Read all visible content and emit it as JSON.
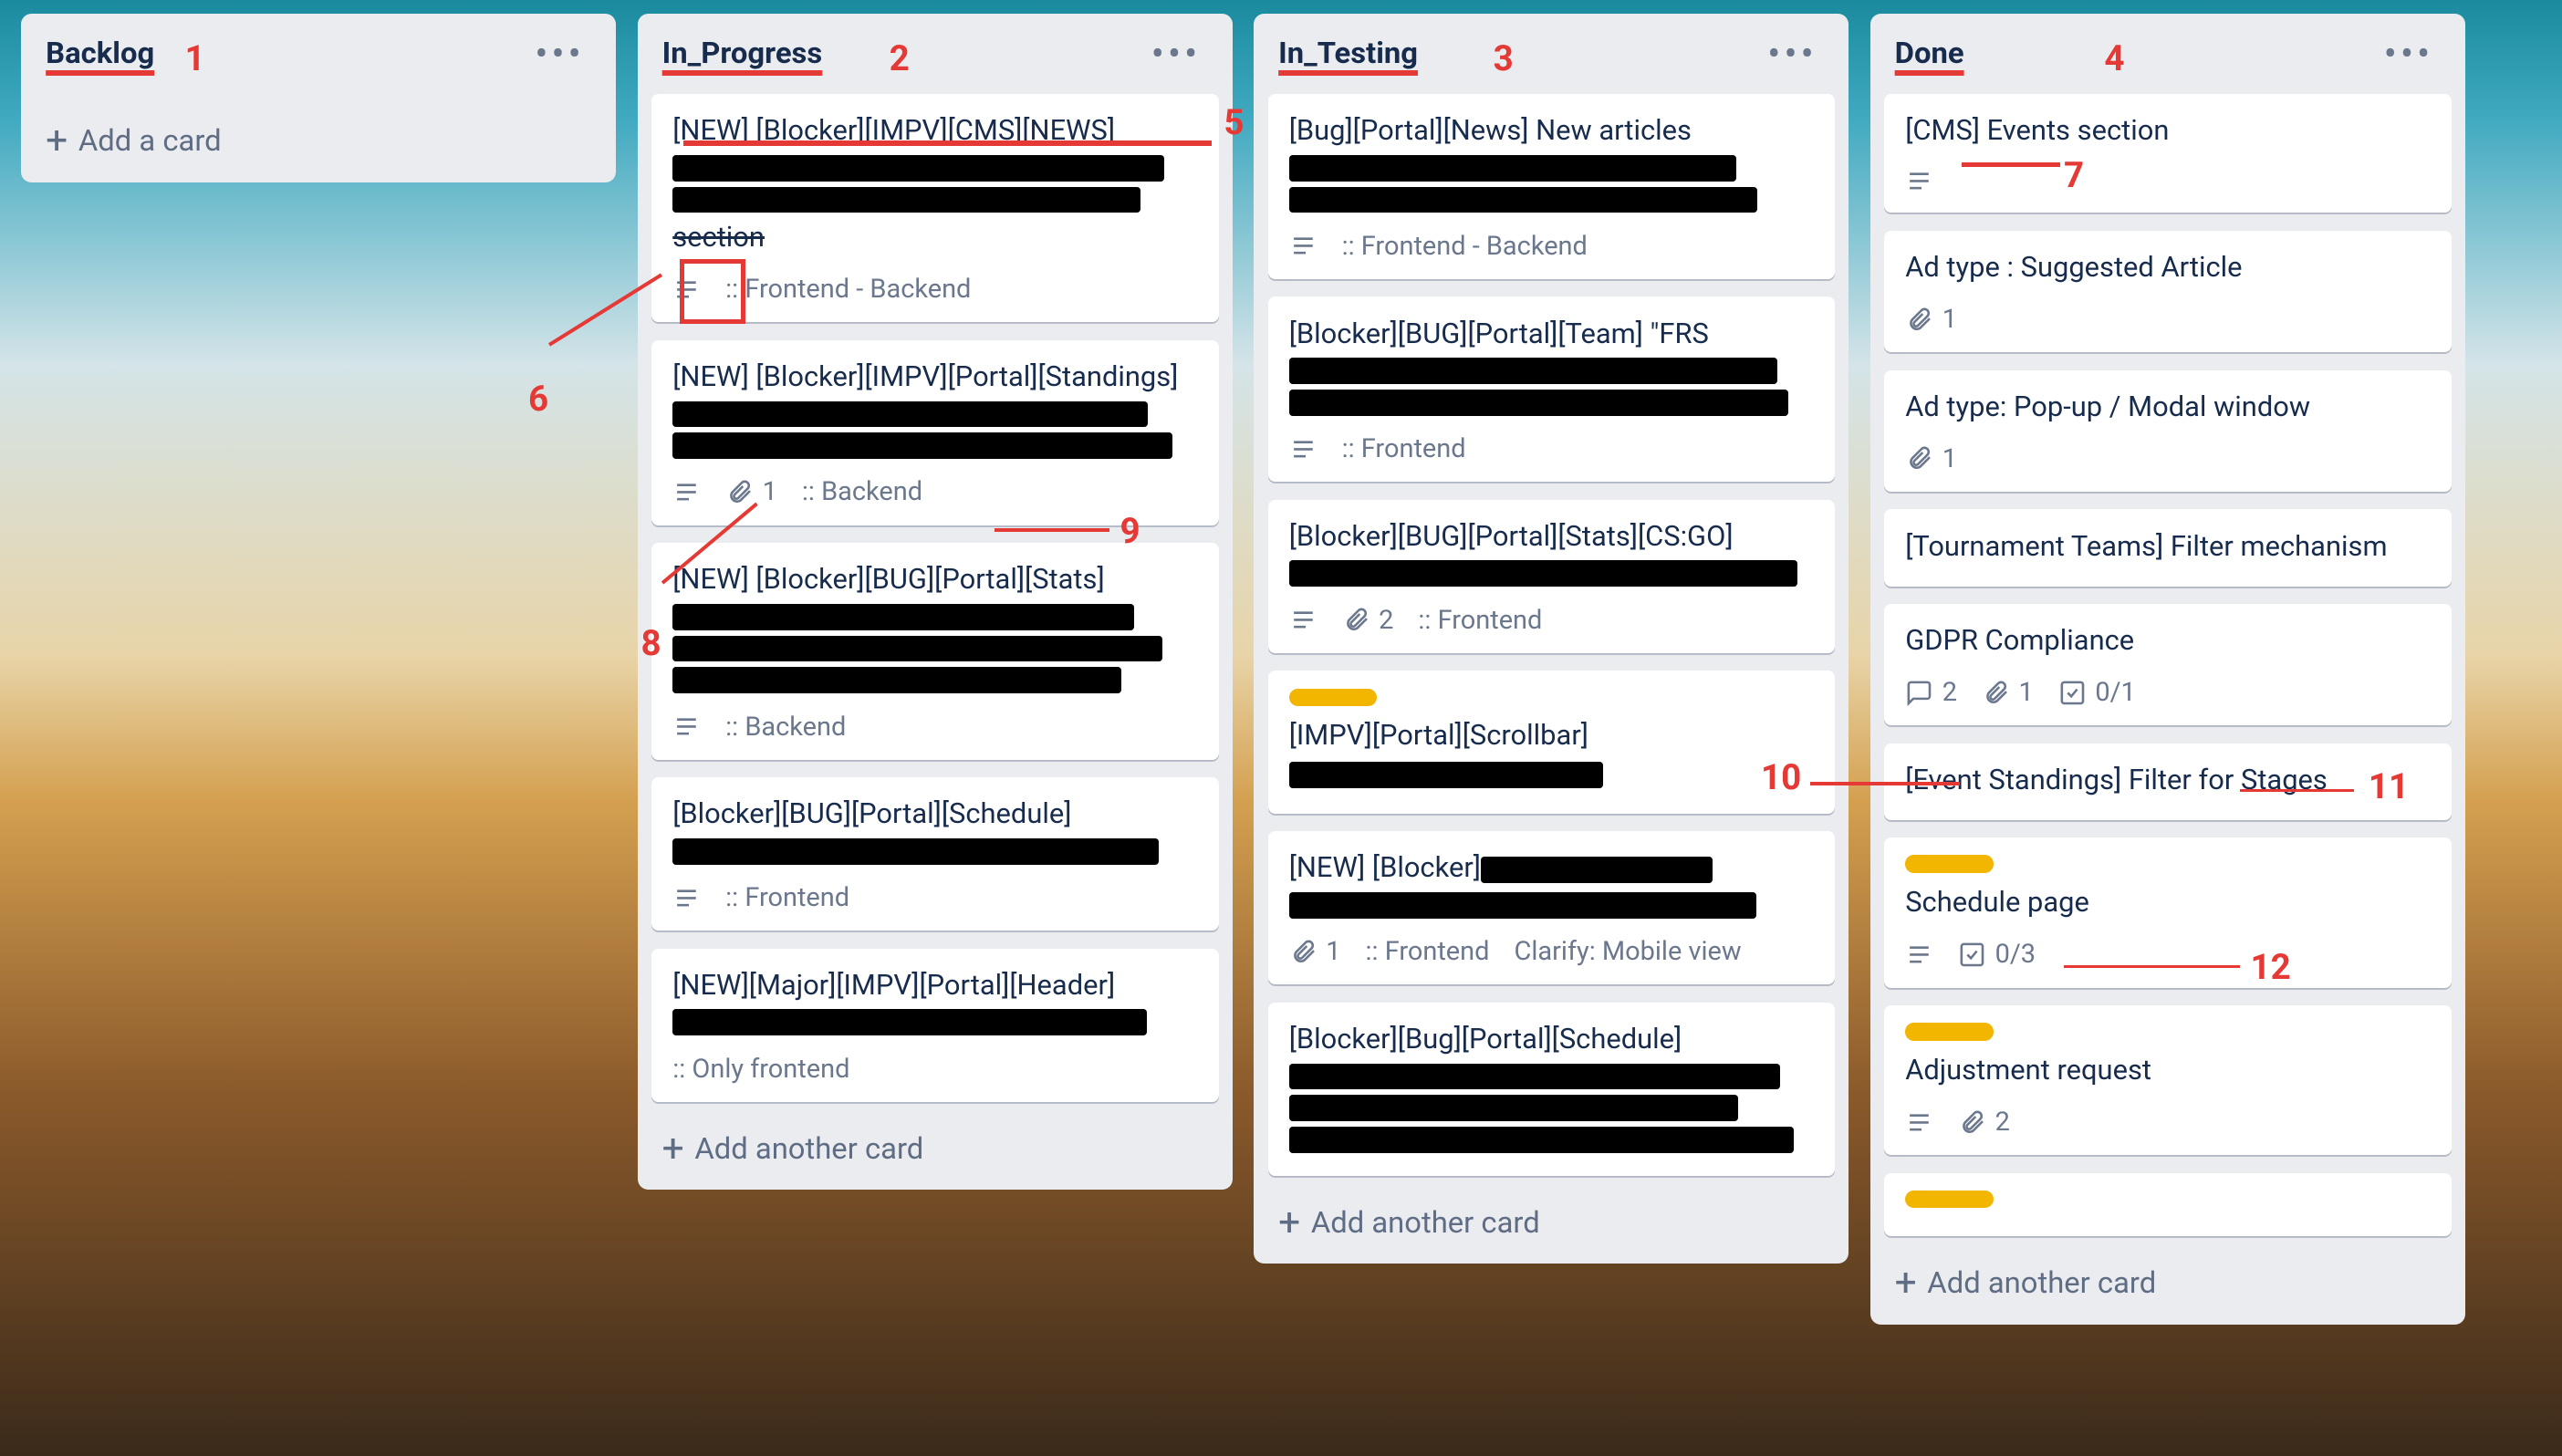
{
  "lists": [
    {
      "id": "backlog",
      "title": "Backlog",
      "annotation": "1",
      "cards": [],
      "add_label": "Add a card"
    },
    {
      "id": "in_progress",
      "title": "In_Progress",
      "annotation": "2",
      "cards": [
        {
          "title_parts": [
            "[NEW] [Blocker][IMPV][CMS][NEWS] ",
            {
              "redacted_lines": 2
            },
            "section"
          ],
          "last_strike": true,
          "badges": [
            {
              "type": "description"
            },
            {
              "type": "text",
              "value": ":: Frontend - Backend"
            }
          ],
          "anno_title": "5"
        },
        {
          "title_parts": [
            "[NEW] [Blocker][IMPV][Portal][Standings] ",
            {
              "redacted_lines": 2
            }
          ],
          "badges": [
            {
              "type": "description"
            },
            {
              "type": "attachment",
              "value": "1"
            },
            {
              "type": "text",
              "value": ":: Backend"
            }
          ],
          "anno_attach": "8",
          "anno_backend": "9"
        },
        {
          "title_parts": [
            "[NEW] [Blocker][BUG][Portal][Stats] ",
            {
              "redacted_lines": 3
            }
          ],
          "badges": [
            {
              "type": "description"
            },
            {
              "type": "text",
              "value": ":: Backend"
            }
          ]
        },
        {
          "title_parts": [
            "[Blocker][BUG][Portal][Schedule] ",
            {
              "redacted_lines": 1
            }
          ],
          "badges": [
            {
              "type": "description"
            },
            {
              "type": "text",
              "value": ":: Frontend"
            }
          ]
        },
        {
          "title_parts": [
            "[NEW][Major][IMPV][Portal][Header] ",
            {
              "redacted_lines": 1
            }
          ],
          "badges": [
            {
              "type": "text",
              "value": ":: Only frontend"
            }
          ]
        }
      ],
      "add_label": "Add another card"
    },
    {
      "id": "in_testing",
      "title": "In_Testing",
      "annotation": "3",
      "cards": [
        {
          "title_parts": [
            "[Bug][Portal][News] New articles ",
            {
              "redacted_lines": 2
            }
          ],
          "badges": [
            {
              "type": "description"
            },
            {
              "type": "text",
              "value": ":: Frontend - Backend"
            }
          ]
        },
        {
          "title_parts": [
            "[Blocker][BUG][Portal][Team] \"FRS ",
            {
              "redacted_lines": 2
            }
          ],
          "badges": [
            {
              "type": "description"
            },
            {
              "type": "text",
              "value": ":: Frontend"
            }
          ]
        },
        {
          "title_parts": [
            "[Blocker][BUG][Portal][Stats][CS:GO] ",
            {
              "redacted_lines": 1
            }
          ],
          "badges": [
            {
              "type": "description"
            },
            {
              "type": "attachment",
              "value": "2"
            },
            {
              "type": "text",
              "value": ":: Frontend"
            }
          ]
        },
        {
          "labels": [
            "yellow"
          ],
          "title_parts": [
            "[IMPV][Portal][Scrollbar]",
            {
              "redacted_lines": 1,
              "inline": true
            }
          ]
        },
        {
          "title_parts": [
            "[NEW] [Blocker]",
            {
              "redacted_lines": 2,
              "inline": true
            }
          ],
          "badges": [
            {
              "type": "attachment",
              "value": "1"
            },
            {
              "type": "text",
              "value": ":: Frontend"
            },
            {
              "type": "text",
              "value": "Clarify: Mobile view"
            }
          ]
        },
        {
          "title_parts": [
            "[Blocker][Bug][Portal][Schedule] ",
            {
              "redacted_lines": 3
            }
          ]
        }
      ],
      "add_label": "Add another card"
    },
    {
      "id": "done",
      "title": "Done",
      "annotation": "4",
      "cards": [
        {
          "title_parts": [
            "[CMS] Events section"
          ],
          "badges": [
            {
              "type": "description"
            }
          ],
          "anno_cms": "7"
        },
        {
          "title_parts": [
            "Ad type : Suggested Article"
          ],
          "badges": [
            {
              "type": "attachment",
              "value": "1"
            }
          ]
        },
        {
          "title_parts": [
            "Ad type: Pop-up / Modal window"
          ],
          "badges": [
            {
              "type": "attachment",
              "value": "1"
            }
          ]
        },
        {
          "title_parts": [
            "[Tournament Teams] Filter mechanism"
          ]
        },
        {
          "title_parts": [
            "GDPR Compliance"
          ],
          "badges": [
            {
              "type": "comment",
              "value": "2"
            },
            {
              "type": "attachment",
              "value": "1"
            },
            {
              "type": "checklist",
              "value": "0/1"
            }
          ],
          "anno_comment": "10",
          "anno_checklist": "11"
        },
        {
          "title_parts": [
            "[Event Standings] Filter for Stages"
          ]
        },
        {
          "labels": [
            "yellow"
          ],
          "title_parts": [
            "Schedule page"
          ],
          "badges": [
            {
              "type": "description"
            },
            {
              "type": "checklist",
              "value": "0/3"
            }
          ],
          "anno_label": "12"
        },
        {
          "labels": [
            "yellow"
          ],
          "title_parts": [
            "Adjustment request"
          ],
          "badges": [
            {
              "type": "description"
            },
            {
              "type": "attachment",
              "value": "2"
            }
          ]
        },
        {
          "labels": [
            "yellow"
          ],
          "title_parts": []
        }
      ],
      "add_label": "Add another card"
    }
  ],
  "annotations": {
    "6": "6"
  }
}
